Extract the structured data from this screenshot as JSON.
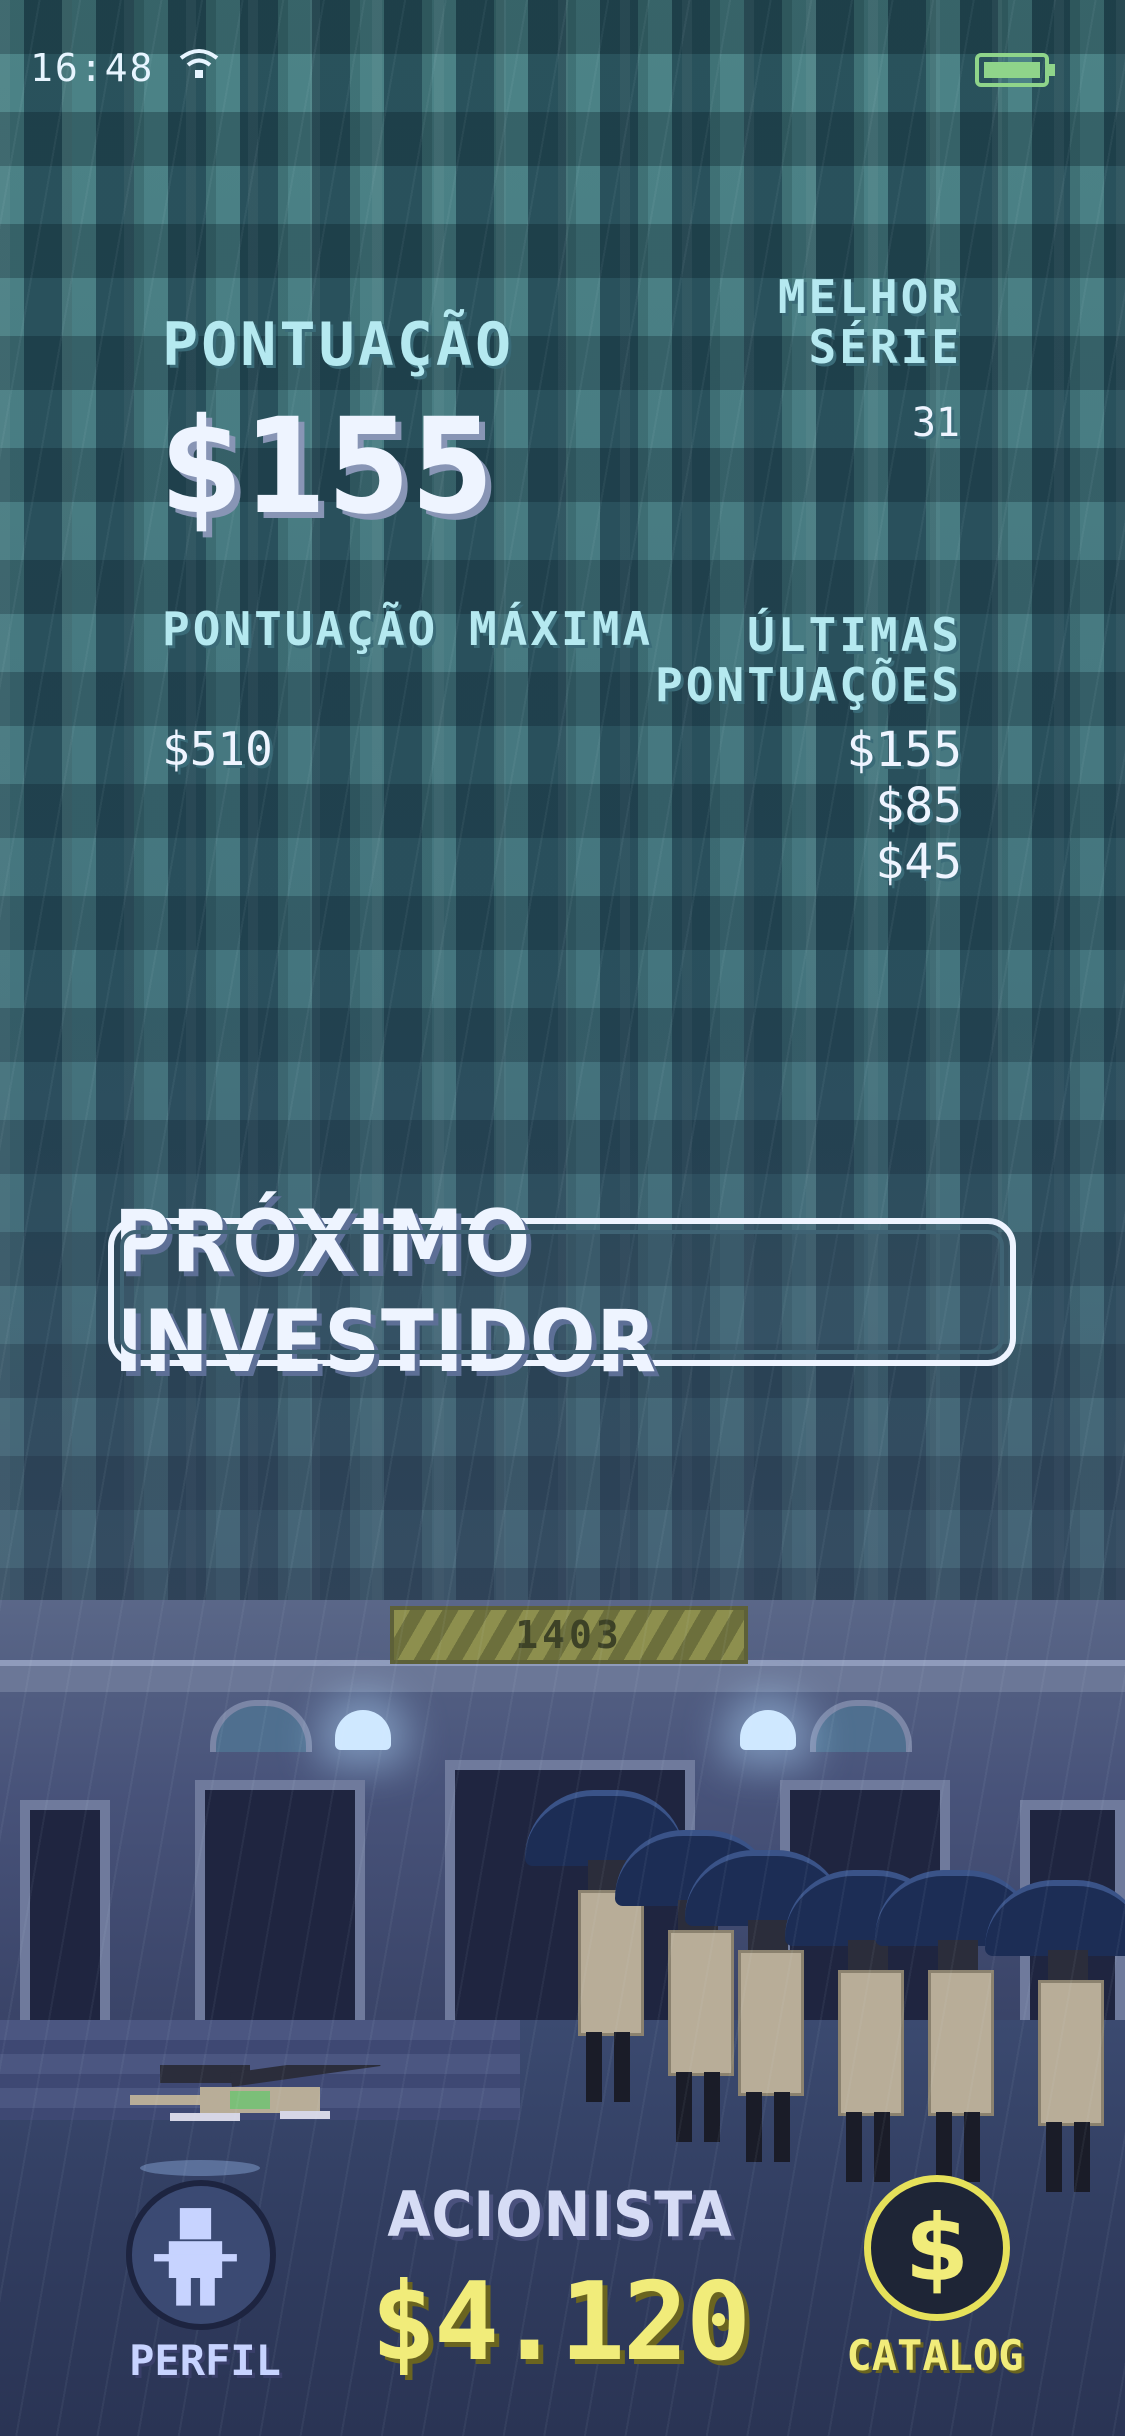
{
  "status_bar": {
    "time": "16:48",
    "wifi_icon": "wifi-icon",
    "battery_icon": "battery-icon",
    "battery_color": "#8fd48a"
  },
  "stats": {
    "score_label": "PONTUAÇÃO",
    "score_value": "$155",
    "best_streak_label": "MELHOR SÉRIE",
    "best_streak_value": "31",
    "max_score_label": "PONTUAÇÃO MÁXIMA",
    "max_score_value": "$510",
    "recent_scores_label": "ÚLTIMAS PONTUAÇÕES",
    "recent_scores": [
      "$155",
      "$85",
      "$45"
    ]
  },
  "actions": {
    "next_investor_label": "PRÓXIMO INVESTIDOR"
  },
  "scene": {
    "building_number": "1403"
  },
  "bottom_bar": {
    "profile_label": "PERFIL",
    "profile_icon": "person-icon",
    "role_label": "ACIONISTA",
    "balance": "$4.120",
    "catalog_label": "CATALOG",
    "catalog_icon": "dollar-coin-icon",
    "balance_color": "#f1ec7a"
  }
}
